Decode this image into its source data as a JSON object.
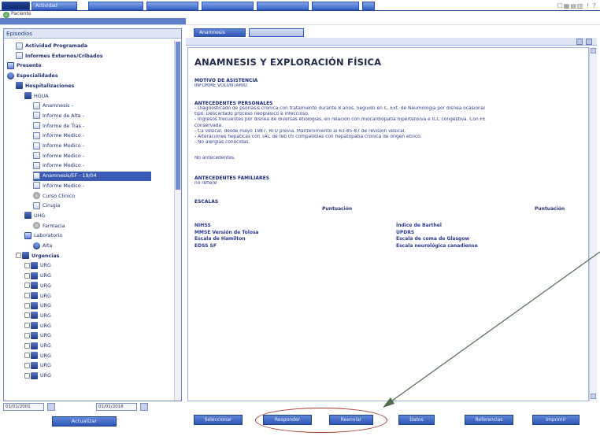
{
  "topbar": {
    "tabs": [
      "Actividad",
      "",
      "",
      "",
      "",
      ""
    ],
    "icons_text": "☐▦▤▥ ! ?"
  },
  "subbar": {
    "label": "Paciente"
  },
  "left_panel": {
    "header": "Episodios",
    "tree": [
      {
        "label": "Actividad Programada",
        "icon": "doc-icon",
        "indent": 1,
        "bold": true
      },
      {
        "label": "Informes Externos/Cribados",
        "icon": "doc-icon",
        "indent": 1,
        "bold": true
      },
      {
        "label": "Presente",
        "icon": "folder-icon",
        "indent": 0,
        "bold": true
      },
      {
        "label": "Especialidades",
        "icon": "people-icon",
        "indent": 0,
        "bold": true
      },
      {
        "label": "Hospitalizaciones",
        "icon": "bed-icon",
        "indent": 1,
        "bold": true
      },
      {
        "label": "HGUA",
        "icon": "bed-icon",
        "indent": 2,
        "bold": false
      },
      {
        "label": "Anamnesis -",
        "icon": "doc-icon",
        "indent": 3,
        "bold": false
      },
      {
        "label": "Informe de Alta -",
        "icon": "doc-icon",
        "indent": 3,
        "bold": false
      },
      {
        "label": "Informe de Tras -",
        "icon": "doc-icon",
        "indent": 3,
        "bold": false
      },
      {
        "label": "Informe Medico -",
        "icon": "doc-icon",
        "indent": 3,
        "bold": false
      },
      {
        "label": "Informe Medico -",
        "icon": "doc-icon",
        "indent": 3,
        "bold": false
      },
      {
        "label": "Informe Medico -",
        "icon": "doc-icon",
        "indent": 3,
        "bold": false
      },
      {
        "label": "Informe Medico -",
        "icon": "doc-icon",
        "indent": 3,
        "bold": false
      },
      {
        "label": "Anamnesis/EF - 19/04",
        "icon": "doc-icon",
        "indent": 3,
        "bold": false,
        "selected": true
      },
      {
        "label": "Informe Medico -",
        "icon": "doc-icon",
        "indent": 3,
        "bold": false
      },
      {
        "label": "Curso Clinico",
        "icon": "gear-icon",
        "indent": 3,
        "bold": false
      },
      {
        "label": "Cirugia",
        "icon": "doc-icon",
        "indent": 3,
        "bold": false
      },
      {
        "label": "UHG",
        "icon": "bed-icon",
        "indent": 2,
        "bold": false
      },
      {
        "label": "Farmacia",
        "icon": "gear-icon",
        "indent": 3,
        "bold": false
      },
      {
        "label": "Laboratorio",
        "icon": "folder-icon",
        "indent": 2,
        "bold": false
      },
      {
        "label": "Alta",
        "icon": "people-icon",
        "indent": 3,
        "bold": false
      },
      {
        "label": "Urgencias",
        "icon": "bed-icon",
        "indent": 1,
        "bold": true
      },
      {
        "label": "URG",
        "icon": "bed-icon",
        "indent": 2,
        "bold": false
      },
      {
        "label": "URG",
        "icon": "bed-icon",
        "indent": 2,
        "bold": false
      },
      {
        "label": "URG",
        "icon": "bed-icon",
        "indent": 2,
        "bold": false
      },
      {
        "label": "URG",
        "icon": "bed-icon",
        "indent": 2,
        "bold": false
      },
      {
        "label": "URG",
        "icon": "bed-icon",
        "indent": 2,
        "bold": false
      },
      {
        "label": "URG",
        "icon": "bed-icon",
        "indent": 2,
        "bold": false
      },
      {
        "label": "URG",
        "icon": "bed-icon",
        "indent": 2,
        "bold": false
      },
      {
        "label": "URG",
        "icon": "bed-icon",
        "indent": 2,
        "bold": false
      },
      {
        "label": "URG",
        "icon": "bed-icon",
        "indent": 2,
        "bold": false
      },
      {
        "label": "URG",
        "icon": "bed-icon",
        "indent": 2,
        "bold": false
      },
      {
        "label": "URG",
        "icon": "bed-icon",
        "indent": 2,
        "bold": false
      },
      {
        "label": "URG",
        "icon": "bed-icon",
        "indent": 2,
        "bold": false
      }
    ],
    "date_from": "01/01/2001",
    "date_to": "01/01/2016",
    "refresh_button": "Actualizar"
  },
  "right_panel": {
    "tabs": [
      "Anamnesis",
      ""
    ],
    "document": {
      "title": "ANAMNESIS Y EXPLORACIÓN FÍSICA",
      "reason_heading": "MOTIVO DE ASISTENCIA",
      "reason_text": "INFORME VOLUNTARIO",
      "personal_heading": "ANTECEDENTES PERSONALES",
      "personal_lines": [
        "- Diagnosticado de psoriasis cronica con tratamiento durante 8 años. Seguido en C. Ext. de Neumologia por disnea ocasional",
        "tipo. Descartado proceso neoplasico e infeccioso.",
        "- Ingresos frecuentes por disnea de diversas etiologias, en relacion con miocardiopatia hipertensiva e ICC congestiva. Con FE",
        "conservada.",
        "- Ca vesical, desde mayo 1987. RTU previa. Mantenimiento al 63-85-87 de revision vesical.",
        "- Alteraciones hepaticas con TAC de feb 05 compatibles con hepatopatia cronica de origen etilico.",
        "- No alergias conocidas."
      ],
      "note_line": "No antecedentes.",
      "family_heading": "ANTECEDENTES FAMILIARES",
      "family_text": "no refiere",
      "scales_heading": "ESCALAS",
      "score_label": "Puntuación",
      "scales_left": [
        "NIHSS",
        "MMSE Versión de Tolosa",
        "Escala de Hamilton",
        "EDSS SF"
      ],
      "scales_right": [
        "Índice de Barthel",
        "UPDRS",
        "Escala de coma de Glasgow",
        "Escala neurológica canadiense"
      ]
    },
    "action_buttons": [
      "Seleccionar",
      "Responder",
      "Reenviar",
      "Datos",
      "Referencias",
      "Imprimir"
    ]
  },
  "colors": {
    "accent": "#2f56b5",
    "tree_selected": "#3b5ab4",
    "annotation": "#a33a2c",
    "arrow": "#4f6b4f"
  }
}
